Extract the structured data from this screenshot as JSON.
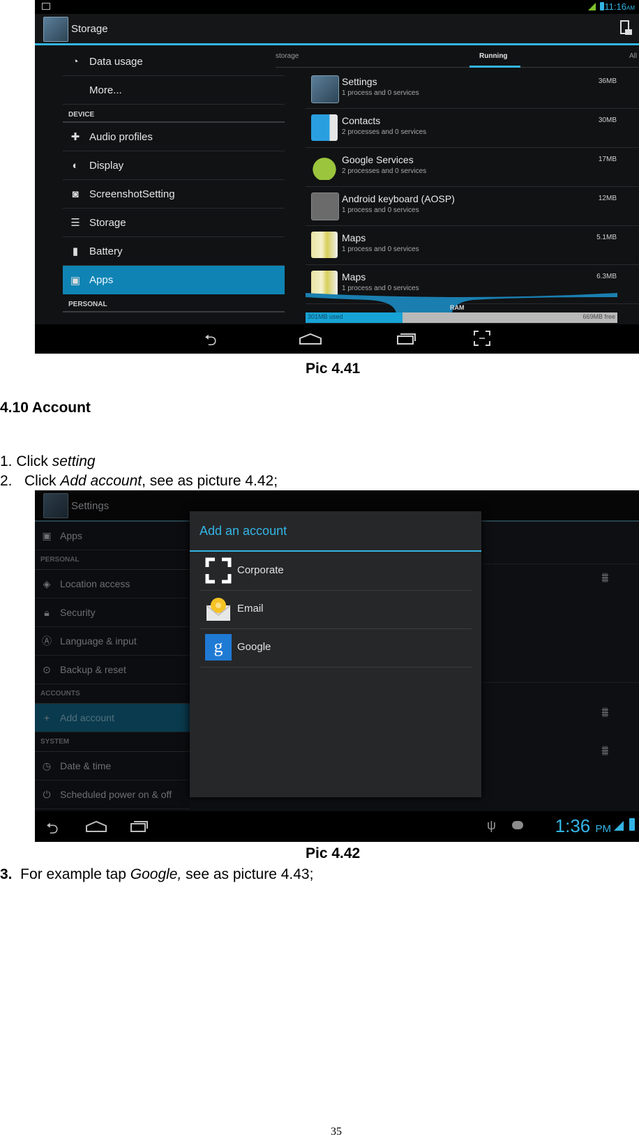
{
  "pic1": {
    "status_bar": {
      "time": "11:16",
      "ampm": "AM"
    },
    "action_bar": {
      "title": "Storage"
    },
    "left_list": [
      {
        "type": "item",
        "icon": "data-usage-icon",
        "label": "Data usage"
      },
      {
        "type": "item",
        "icon": "",
        "label": "More..."
      },
      {
        "type": "header",
        "label": "DEVICE"
      },
      {
        "type": "item",
        "icon": "audio-profiles-icon",
        "label": "Audio profiles"
      },
      {
        "type": "item",
        "icon": "display-icon",
        "label": "Display"
      },
      {
        "type": "item",
        "icon": "camera-icon",
        "label": "ScreenshotSetting"
      },
      {
        "type": "item",
        "icon": "storage-icon",
        "label": "Storage"
      },
      {
        "type": "item",
        "icon": "battery-icon",
        "label": "Battery"
      },
      {
        "type": "item",
        "icon": "apps-icon",
        "label": "Apps",
        "selected": true
      },
      {
        "type": "header",
        "label": "PERSONAL"
      }
    ],
    "tabs": [
      {
        "label": "storage",
        "active": false
      },
      {
        "label": "Running",
        "active": true
      },
      {
        "label": "All",
        "active": false
      }
    ],
    "processes": [
      {
        "name": "Settings",
        "detail": "1 process and 0 services",
        "size": "36MB",
        "icon": "settings-app-icon"
      },
      {
        "name": "Contacts",
        "detail": "2 processes and 0 services",
        "size": "30MB",
        "icon": "contacts-app-icon"
      },
      {
        "name": "Google Services",
        "detail": "2 processes and 0 services",
        "size": "17MB",
        "icon": "android-icon"
      },
      {
        "name": "Android keyboard (AOSP)",
        "detail": "1 process and 0 services",
        "size": "12MB",
        "icon": "keyboard-icon"
      },
      {
        "name": "Maps",
        "detail": "1 process and 0 services",
        "size": "5.1MB",
        "icon": "maps-icon"
      },
      {
        "name": "Maps",
        "detail": "1 process and 0 services",
        "size": "6.3MB",
        "icon": "maps-icon"
      }
    ],
    "ram": {
      "label": "RAM",
      "used": "301MB used",
      "free": "669MB free",
      "used_fraction": 0.31
    }
  },
  "captions": {
    "pic1": "Pic 4.41",
    "pic2": "Pic 4.42"
  },
  "section_title": "4.10 Account",
  "steps": {
    "s1_prefix": "1. Click ",
    "s1_em": "setting",
    "s2_prefix": "2.   Click ",
    "s2_em": "Add account",
    "s2_suffix": ", see as picture 4.42;",
    "s3_num": "3.",
    "s3_prefix": "  For example tap ",
    "s3_em": "Google,",
    "s3_suffix": " see as picture 4.43;"
  },
  "pic2": {
    "action_bar": {
      "title": "Settings"
    },
    "left_list": [
      {
        "type": "item",
        "icon": "apps-icon",
        "label": "Apps"
      },
      {
        "type": "header",
        "label": "PERSONAL"
      },
      {
        "type": "item",
        "icon": "location-icon",
        "label": "Location access"
      },
      {
        "type": "item",
        "icon": "lock-icon",
        "label": "Security"
      },
      {
        "type": "item",
        "icon": "language-icon",
        "label": "Language & input"
      },
      {
        "type": "item",
        "icon": "backup-icon",
        "label": "Backup & reset"
      },
      {
        "type": "header",
        "label": "ACCOUNTS"
      },
      {
        "type": "item",
        "icon": "plus-icon",
        "label": "Add account",
        "selected": true
      },
      {
        "type": "header",
        "label": "SYSTEM"
      },
      {
        "type": "item",
        "icon": "clock-icon",
        "label": "Date & time"
      },
      {
        "type": "item",
        "icon": "power-icon",
        "label": "Scheduled power on & off"
      }
    ],
    "dialog": {
      "title": "Add an account",
      "options": [
        {
          "label": "Corporate",
          "icon": "corporate-icon"
        },
        {
          "label": "Email",
          "icon": "email-icon"
        },
        {
          "label": "Google",
          "icon": "google-icon"
        }
      ]
    },
    "status_bar": {
      "time": "1:36",
      "ampm": "PM"
    }
  },
  "page_number": "35",
  "colors": {
    "accent": "#33b5e5",
    "selected": "#0f84b4"
  }
}
